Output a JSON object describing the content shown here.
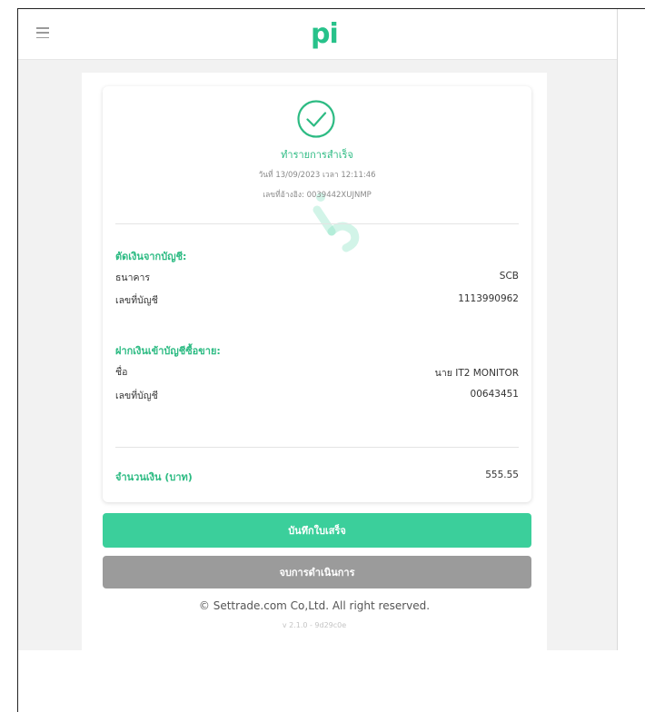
{
  "header": {
    "logo_text": "pi",
    "menu_icon": "hamburger-icon",
    "brand_color": "#27c28a"
  },
  "status": {
    "icon": "check-circle-icon",
    "title": "ทำรายการสำเร็จ",
    "date_line": "วันที่ 13/09/2023 เวลา 12:11:46",
    "ref_line": "เลขที่อ้างอิง: 0039442XUJNMP"
  },
  "debit": {
    "section_title": "ตัดเงินจากบัญชี:",
    "bank_label": "ธนาคาร",
    "bank_value": "SCB",
    "account_label": "เลขที่บัญชี",
    "account_value": "1113990962"
  },
  "deposit": {
    "section_title": "ฝากเงินเข้าบัญชีซื้อขาย:",
    "name_label": "ชื่อ",
    "name_value": "นาย IT2 MONITOR",
    "account_label": "เลขที่บัญชี",
    "account_value": "00643451"
  },
  "amount": {
    "label": "จำนวนเงิน (บาท)",
    "value": "555.55"
  },
  "buttons": {
    "save_label": "บันทึกใบเสร็จ",
    "done_label": "จบการดำเนินการ",
    "save_color": "#3bcf9b",
    "done_color": "#9b9b9b"
  },
  "footer": {
    "copyright": "© Settrade.com Co,Ltd. All right reserved.",
    "version": "v 2.1.0 - 9d29c0e"
  }
}
